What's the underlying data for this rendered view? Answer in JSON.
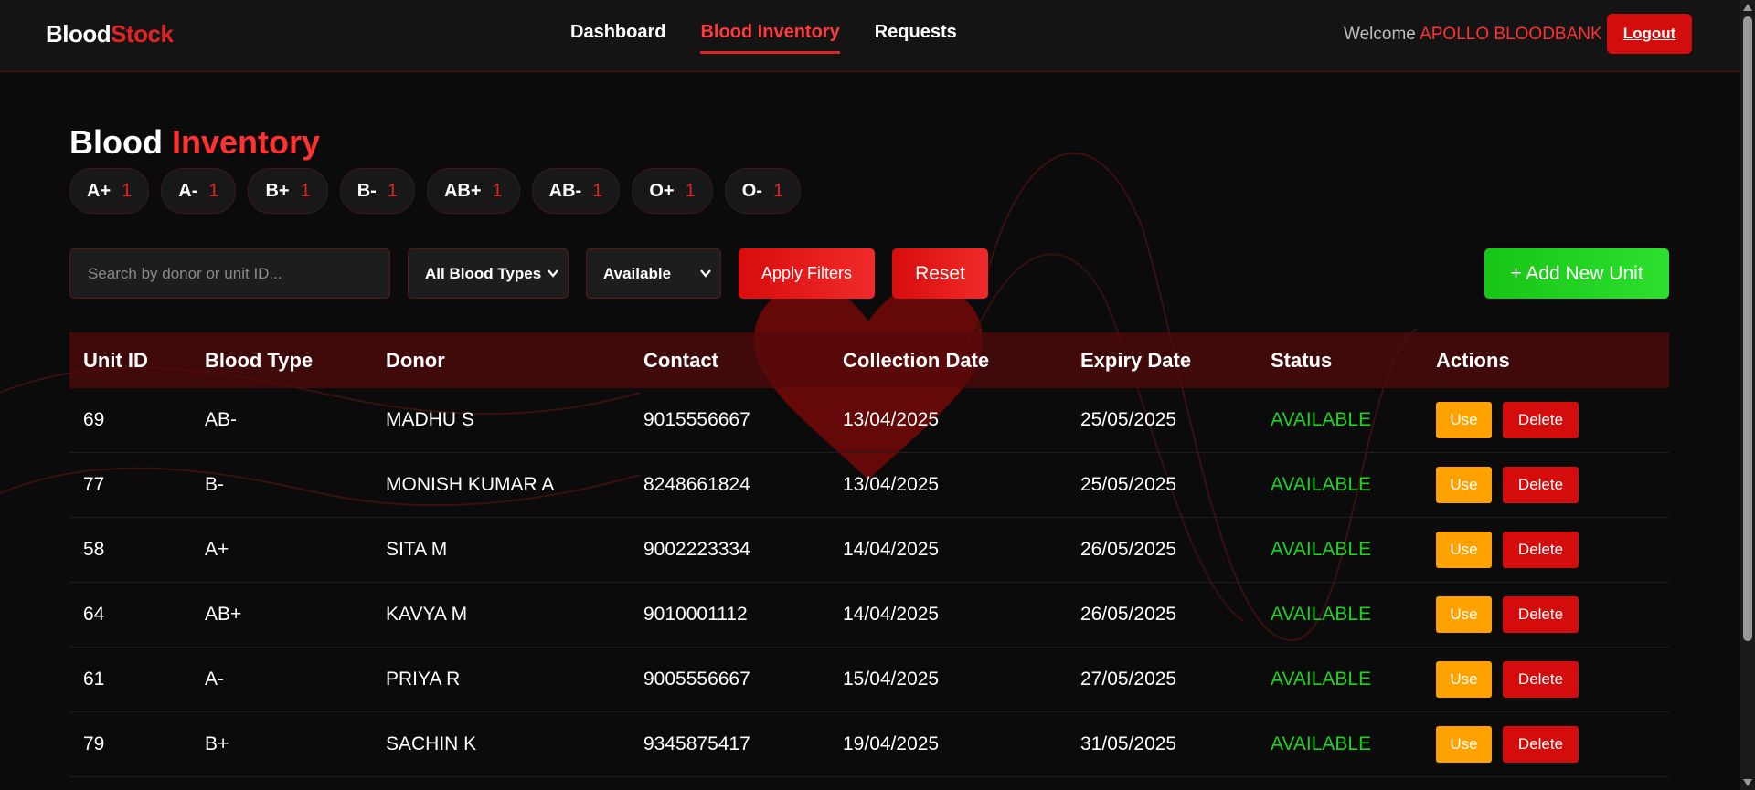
{
  "header": {
    "logo_part1": "Blood",
    "logo_part2": "Stock",
    "nav": [
      {
        "label": "Dashboard",
        "active": false
      },
      {
        "label": "Blood Inventory",
        "active": true
      },
      {
        "label": "Requests",
        "active": false
      }
    ],
    "welcome_label": "Welcome",
    "user_name": "APOLLO BLOODBANK",
    "logout_label": "Logout"
  },
  "page": {
    "title_part1": "Blood",
    "title_part2": "Inventory"
  },
  "blood_counts": [
    {
      "type": "A+",
      "count": "1"
    },
    {
      "type": "A-",
      "count": "1"
    },
    {
      "type": "B+",
      "count": "1"
    },
    {
      "type": "B-",
      "count": "1"
    },
    {
      "type": "AB+",
      "count": "1"
    },
    {
      "type": "AB-",
      "count": "1"
    },
    {
      "type": "O+",
      "count": "1"
    },
    {
      "type": "O-",
      "count": "1"
    }
  ],
  "filters": {
    "search_placeholder": "Search by donor or unit ID...",
    "blood_type_selected": "All Blood Types",
    "status_selected": "Available",
    "apply_label": "Apply Filters",
    "reset_label": "Reset",
    "add_label": "+ Add New Unit"
  },
  "table": {
    "headers": [
      "Unit ID",
      "Blood Type",
      "Donor",
      "Contact",
      "Collection Date",
      "Expiry Date",
      "Status",
      "Actions"
    ],
    "rows": [
      {
        "unit_id": "69",
        "blood_type": "AB-",
        "donor": "MADHU S",
        "contact": "9015556667",
        "collection": "13/04/2025",
        "expiry": "25/05/2025",
        "status": "AVAILABLE"
      },
      {
        "unit_id": "77",
        "blood_type": "B-",
        "donor": "MONISH KUMAR A",
        "contact": "8248661824",
        "collection": "13/04/2025",
        "expiry": "25/05/2025",
        "status": "AVAILABLE"
      },
      {
        "unit_id": "58",
        "blood_type": "A+",
        "donor": "SITA M",
        "contact": "9002223334",
        "collection": "14/04/2025",
        "expiry": "26/05/2025",
        "status": "AVAILABLE"
      },
      {
        "unit_id": "64",
        "blood_type": "AB+",
        "donor": "KAVYA M",
        "contact": "9010001112",
        "collection": "14/04/2025",
        "expiry": "26/05/2025",
        "status": "AVAILABLE"
      },
      {
        "unit_id": "61",
        "blood_type": "A-",
        "donor": "PRIYA R",
        "contact": "9005556667",
        "collection": "15/04/2025",
        "expiry": "27/05/2025",
        "status": "AVAILABLE"
      },
      {
        "unit_id": "79",
        "blood_type": "B+",
        "donor": "SACHIN K",
        "contact": "9345875417",
        "collection": "19/04/2025",
        "expiry": "31/05/2025",
        "status": "AVAILABLE"
      }
    ],
    "use_label": "Use",
    "delete_label": "Delete"
  },
  "colors": {
    "accent_red": "#e02424",
    "status_green": "#1fd21f",
    "use_orange": "#ffa200",
    "add_green": "#2ee02e"
  },
  "icons": {
    "select_chevron": "chevron-down-icon",
    "background": "heart-icon"
  }
}
